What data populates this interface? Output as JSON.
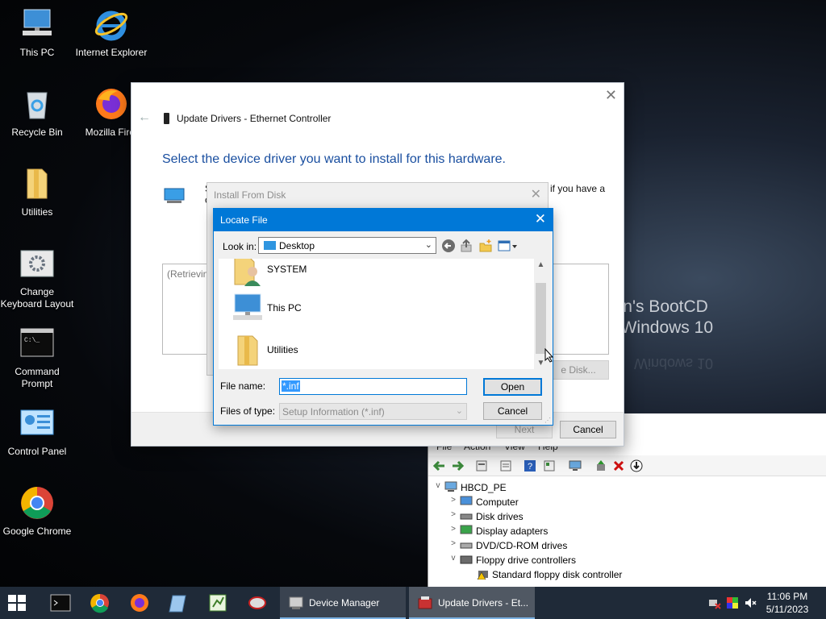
{
  "desktop": {
    "icons": [
      {
        "label": "This PC"
      },
      {
        "label": "Internet Explorer"
      },
      {
        "label": "Recycle Bin"
      },
      {
        "label": "Mozilla Firef"
      },
      {
        "label": "Utilities"
      },
      {
        "label": "Change Keyboard Layout"
      },
      {
        "label": "Command Prompt"
      },
      {
        "label": "Control Panel"
      },
      {
        "label": "Google Chrome"
      }
    ],
    "wallpaper": {
      "line1": "en's BootCD",
      "line2": "Windows 10",
      "reflect": "Windows 10"
    }
  },
  "update_drivers": {
    "title": "Update Drivers - Ethernet Controller",
    "heading": "Select the device driver you want to install for this hardware.",
    "desc_fragment_1": "S",
    "desc_fragment_2": "c",
    "desc_fragment_right": "if you have a",
    "list_text": "(Retrievin",
    "have_disk_label": "e Disk...",
    "next_label": "Next",
    "cancel_label": "Cancel",
    "close_glyph": "✕"
  },
  "install_from_disk": {
    "title": "Install From Disk",
    "close_glyph": "✕"
  },
  "locate_file": {
    "title": "Locate File",
    "close_glyph": "✕",
    "look_in_label": "Look in:",
    "look_in_value": "Desktop",
    "items": [
      {
        "name": "SYSTEM",
        "icon": "user-folder-icon"
      },
      {
        "name": "This PC",
        "icon": "computer-icon"
      },
      {
        "name": "Utilities",
        "icon": "folder-icon"
      }
    ],
    "file_name_label": "File name:",
    "file_name_value": "*.inf",
    "files_of_type_label": "Files of type:",
    "files_of_type_value": "Setup Information (*.inf)",
    "open_label": "Open",
    "cancel_label": "Cancel"
  },
  "device_manager": {
    "menu": [
      "File",
      "Action",
      "View",
      "Help"
    ],
    "tree": [
      {
        "label": "HBCD_PE",
        "expander": "v",
        "level": 0
      },
      {
        "label": "Computer",
        "expander": ">",
        "level": 1
      },
      {
        "label": "Disk drives",
        "expander": ">",
        "level": 1
      },
      {
        "label": "Display adapters",
        "expander": ">",
        "level": 1
      },
      {
        "label": "DVD/CD-ROM drives",
        "expander": ">",
        "level": 1
      },
      {
        "label": "Floppy drive controllers",
        "expander": "v",
        "level": 1
      },
      {
        "label": "Standard floppy disk controller",
        "expander": "",
        "level": 2
      }
    ]
  },
  "taskbar": {
    "tasks": [
      {
        "label": "Device Manager"
      },
      {
        "label": "Update Drivers - Et..."
      }
    ],
    "time": "11:06 PM",
    "date": "5/11/2023"
  },
  "colors": {
    "accent": "#0078d7",
    "heading_blue": "#1a4fa0",
    "taskbar": "#1f2a38"
  }
}
